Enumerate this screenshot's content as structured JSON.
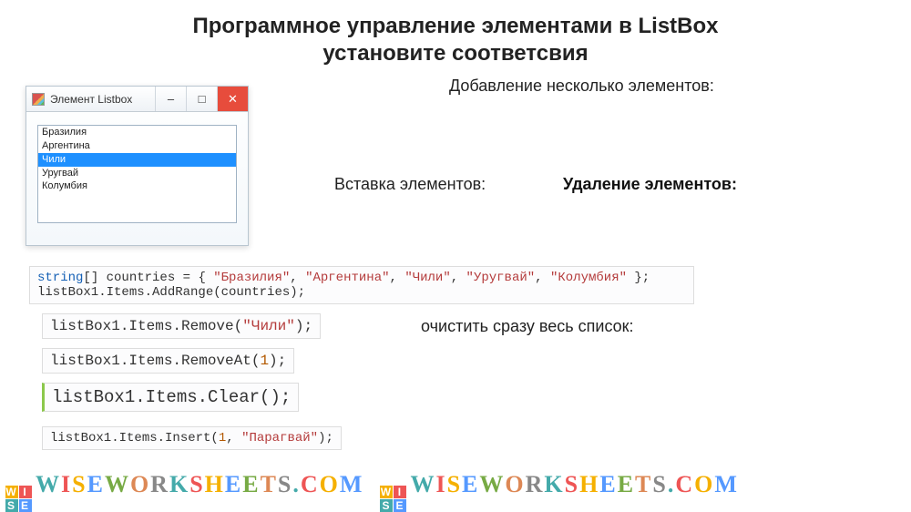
{
  "title_line1": "Программное управление элементами в ListBox",
  "title_line2": "установите соответсвия",
  "window": {
    "title": "Элемент Listbox",
    "items": [
      "Бразилия",
      "Аргентина",
      "Чили",
      "Уругвай",
      "Колумбия"
    ],
    "selected_index": 2,
    "minimize": "–",
    "maximize": "□",
    "close": "✕"
  },
  "labels": {
    "add": "Добавление несколько элементов:",
    "insert": "Вставка элементов:",
    "remove": "Удаление элементов:",
    "clear": "очистить сразу весь список:"
  },
  "code": {
    "countries_decl_kw": "string",
    "countries_decl_rest": "[] countries = { ",
    "countries_vals": [
      "\"Бразилия\"",
      "\"Аргентина\"",
      "\"Чили\"",
      "\"Уругвай\"",
      "\"Колумбия\""
    ],
    "countries_decl_end": " };",
    "addrange": "listBox1.Items.AddRange(countries);",
    "remove_pre": "listBox1.Items.Remove(",
    "remove_arg": "\"Чили\"",
    "remove_post": ");",
    "removeat_pre": "listBox1.Items.RemoveAt(",
    "removeat_arg": "1",
    "removeat_post": ");",
    "clear_stmt": "listBox1.Items.Clear();",
    "insert_pre": "listBox1.Items.Insert(",
    "insert_arg_num": "1",
    "insert_sep": ", ",
    "insert_arg_str": "\"Парагвай\"",
    "insert_post": ");"
  },
  "watermark": {
    "badge": [
      "W",
      "I",
      "S",
      "E"
    ],
    "text": "WISEWORKSHEETS.COM"
  }
}
